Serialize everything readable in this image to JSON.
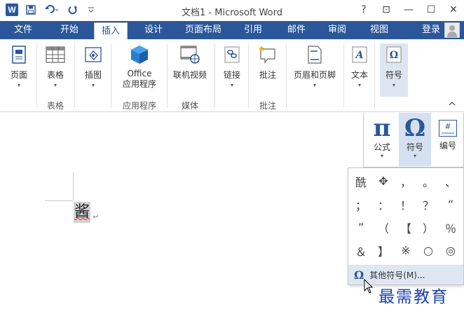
{
  "titlebar": {
    "title": "文档1 - Microsoft Word",
    "app_icon": "W",
    "qat": [
      {
        "name": "save-icon",
        "glyph": "💾"
      },
      {
        "name": "undo-icon",
        "glyph": "↶"
      },
      {
        "name": "redo-icon",
        "glyph": "↻"
      },
      {
        "name": "customize-qat-icon",
        "glyph": "="
      }
    ],
    "controls": [
      "?",
      "⊡",
      "—",
      "☐",
      "✕"
    ]
  },
  "tabs": {
    "file": "文件",
    "items": [
      "开始",
      "插入",
      "设计",
      "页面布局",
      "引用",
      "邮件",
      "审阅",
      "视图"
    ],
    "active": "插入",
    "login": "登录"
  },
  "ribbon": {
    "buttons": [
      {
        "label": "页面",
        "icon": "page-icon"
      },
      {
        "label": "表格",
        "icon": "table-icon"
      },
      {
        "label": "插图",
        "icon": "illustrations-icon"
      },
      {
        "label": "Office\n应用程序",
        "icon": "office-apps-icon"
      },
      {
        "label": "联机视频",
        "icon": "online-video-icon"
      },
      {
        "label": "链接",
        "icon": "link-icon"
      },
      {
        "label": "批注",
        "icon": "comment-icon"
      },
      {
        "label": "页眉和页脚",
        "icon": "header-footer-icon"
      },
      {
        "label": "文本",
        "icon": "text-icon"
      },
      {
        "label": "符号",
        "icon": "symbol-icon"
      }
    ],
    "groups": [
      "表格",
      "应用程序",
      "媒体",
      "批注"
    ]
  },
  "document": {
    "char": "酱",
    "para_mark": "↵"
  },
  "symbol_menu": {
    "formula": {
      "glyph": "π",
      "label": "公式"
    },
    "symbol": {
      "glyph": "Ω",
      "label": "符号"
    },
    "numbering": {
      "glyph": "#",
      "label": "编号"
    },
    "gallery": [
      "酰",
      "✥",
      "，",
      "。",
      "、",
      "；",
      "：",
      "！",
      "？",
      "“",
      "”",
      "（",
      "【",
      "）",
      "％",
      "＆",
      "】",
      "※",
      "○",
      "◎"
    ],
    "more_label": "其他符号(M)..."
  },
  "watermark": "最需教育",
  "colors": {
    "accent": "#2b579a",
    "watermark": "#1a3fb3"
  }
}
